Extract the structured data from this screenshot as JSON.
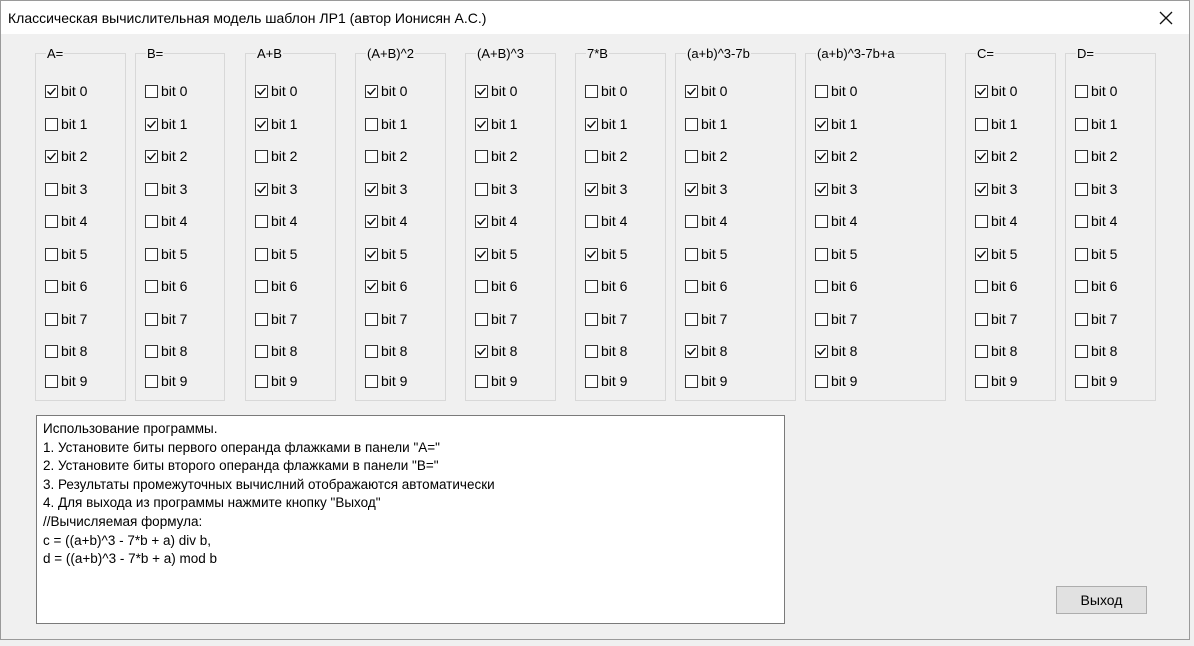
{
  "window": {
    "title": "Классическая вычислительная модель шаблон ЛР1 (автор Ионисян  А.С.)"
  },
  "groups": [
    {
      "title": "A=",
      "bits": [
        1,
        0,
        1,
        0,
        0,
        0,
        0,
        0,
        0,
        0
      ]
    },
    {
      "title": "B=",
      "bits": [
        0,
        1,
        1,
        0,
        0,
        0,
        0,
        0,
        0,
        0
      ]
    },
    {
      "title": "A+B",
      "bits": [
        1,
        1,
        0,
        1,
        0,
        0,
        0,
        0,
        0,
        0
      ]
    },
    {
      "title": "(A+B)^2",
      "bits": [
        1,
        0,
        0,
        1,
        1,
        1,
        1,
        0,
        0,
        0
      ]
    },
    {
      "title": "(A+B)^3",
      "bits": [
        1,
        1,
        0,
        0,
        1,
        1,
        0,
        0,
        1,
        0
      ]
    },
    {
      "title": "7*B",
      "bits": [
        0,
        1,
        0,
        1,
        0,
        1,
        0,
        0,
        0,
        0
      ]
    },
    {
      "title": "(a+b)^3-7b",
      "bits": [
        1,
        0,
        0,
        1,
        0,
        0,
        0,
        0,
        1,
        0
      ]
    },
    {
      "title": "(a+b)^3-7b+a",
      "bits": [
        0,
        1,
        1,
        1,
        0,
        0,
        0,
        0,
        1,
        0
      ]
    },
    {
      "title": "C=",
      "bits": [
        1,
        0,
        1,
        1,
        0,
        1,
        0,
        0,
        0,
        0
      ]
    },
    {
      "title": "D=",
      "bits": [
        0,
        0,
        0,
        0,
        0,
        0,
        0,
        0,
        0,
        0
      ]
    }
  ],
  "bit_labels": [
    "bit 0",
    "bit 1",
    "bit 2",
    "bit 3",
    "bit 4",
    "bit 5",
    "bit 6",
    "bit 7",
    "bit 8",
    "bit 9"
  ],
  "help_text": [
    "Использование программы.",
    "1. Установите биты первого операнда флажками в панели \"A=\"",
    "2. Установите биты второго операнда флажками в панели \"B=\"",
    "3. Результаты промежуточных вычислний отображаются автоматически",
    "4. Для выхода из программы нажмите кнопку \"Выход\"",
    "//Вычисляемая формула:",
    "c = ((a+b)^3 - 7*b + a) div b,",
    "d = ((a+b)^3 - 7*b + a) mod b"
  ],
  "exit_button": "Выход"
}
